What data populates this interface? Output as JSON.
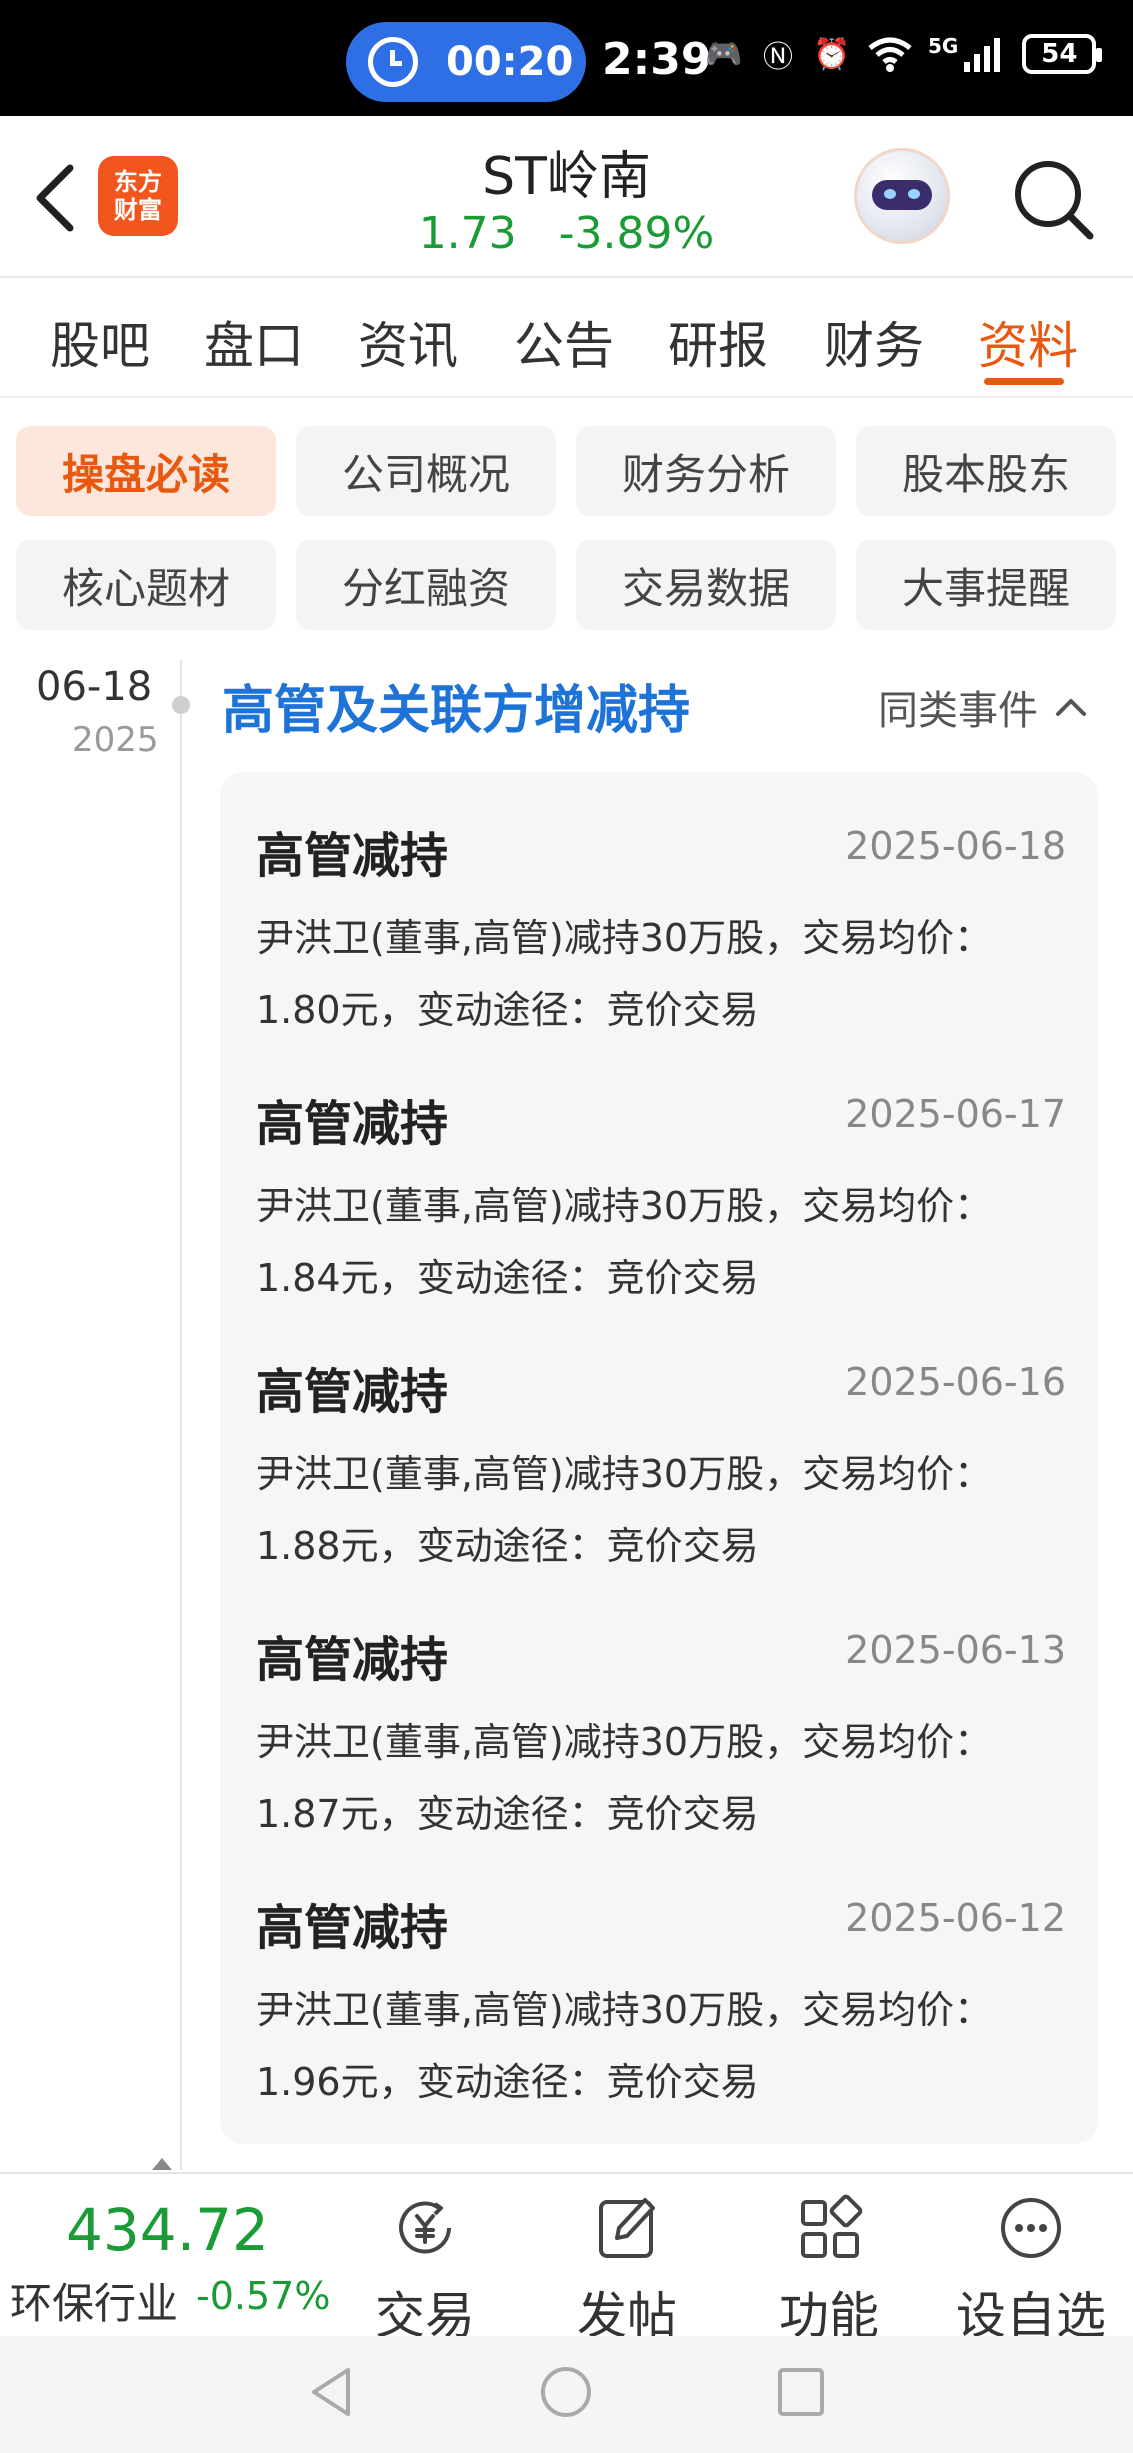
{
  "status_bar": {
    "alarm_time": "00:20",
    "time": "2:39",
    "network": "5G",
    "battery": "54"
  },
  "header": {
    "logo_text": "东方财富",
    "stock_name": "ST岭南",
    "price": "1.73",
    "change_pct": "-3.89%"
  },
  "tabs": [
    "股吧",
    "盘口",
    "资讯",
    "公告",
    "研报",
    "财务",
    "资料"
  ],
  "active_tab": "资料",
  "chips": [
    "操盘必读",
    "公司概况",
    "财务分析",
    "股本股东",
    "核心题材",
    "分红融资",
    "交易数据",
    "大事提醒"
  ],
  "active_chip": "操盘必读",
  "timeline": {
    "date_md": "06-18",
    "date_year": "2025",
    "section_title": "高管及关联方增减持",
    "similar_events": "同类事件"
  },
  "events": [
    {
      "title": "高管减持",
      "date": "2025-06-18",
      "desc": "尹洪卫(董事,高管)减持30万股，交易均价：1.80元，变动途径：竞价交易"
    },
    {
      "title": "高管减持",
      "date": "2025-06-17",
      "desc": "尹洪卫(董事,高管)减持30万股，交易均价：1.84元，变动途径：竞价交易"
    },
    {
      "title": "高管减持",
      "date": "2025-06-16",
      "desc": "尹洪卫(董事,高管)减持30万股，交易均价：1.88元，变动途径：竞价交易"
    },
    {
      "title": "高管减持",
      "date": "2025-06-13",
      "desc": "尹洪卫(董事,高管)减持30万股，交易均价：1.87元，变动途径：竞价交易"
    },
    {
      "title": "高管减持",
      "date": "2025-06-12",
      "desc": "尹洪卫(董事,高管)减持30万股，交易均价：1.96元，变动途径：竞价交易"
    }
  ],
  "toolbar": {
    "index_value": "434.72",
    "index_name": "环保行业",
    "index_change": "-0.57%",
    "trade": "交易",
    "post": "发帖",
    "functions": "功能",
    "add_watch": "设自选"
  },
  "colors": {
    "accent": "#e8580f",
    "fall": "#1b9b35",
    "link": "#1e73d8"
  }
}
